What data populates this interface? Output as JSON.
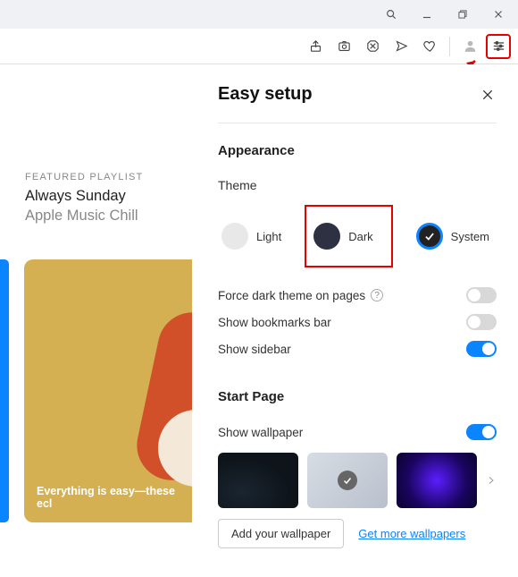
{
  "panel": {
    "title": "Easy setup",
    "appearance_title": "Appearance",
    "theme_label": "Theme",
    "themes": {
      "light": "Light",
      "dark": "Dark",
      "system": "System"
    },
    "force_dark": "Force dark theme on pages",
    "bookmarks": "Show bookmarks bar",
    "sidebar": "Show sidebar",
    "start_page_title": "Start Page",
    "show_wallpaper": "Show wallpaper",
    "add_wallpaper": "Add your wallpaper",
    "more_wallpapers": "Get more wallpapers"
  },
  "featured": {
    "label": "FEATURED PLAYLIST",
    "title": "Always Sunday",
    "subtitle": "Apple Music Chill",
    "caption": "Everything is easy—these ecl"
  }
}
